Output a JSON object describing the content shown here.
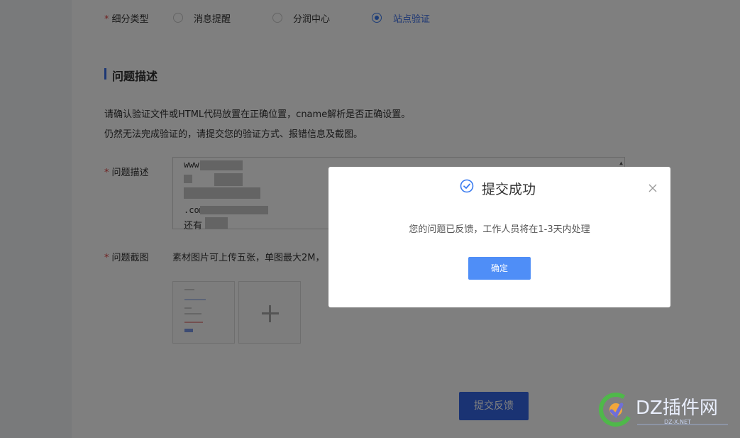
{
  "form": {
    "subtype": {
      "label": "细分类型",
      "options": [
        "消息提醒",
        "分润中心",
        "站点验证"
      ],
      "selected": "站点验证"
    },
    "section_title": "问题描述",
    "hint_line1": "请确认验证文件或HTML代码放置在正确位置，cname解析是否正确设置。",
    "hint_line2": "仍然无法完成验证的，请提交您的验证方式、报错信息及截图。",
    "desc_label": "问题描述",
    "desc_text": {
      "line1": "www.      .cn",
      "line2": "",
      "line3": "",
      "line4": "         .com",
      "line5": "还有"
    },
    "screenshot_label": "问题截图",
    "screenshot_hint": "素材图片可上传五张，单图最大2M，",
    "submit_label": "提交反馈"
  },
  "modal": {
    "title": "提交成功",
    "message": "您的问题已反馈，工作人员将在1-3天内处理",
    "ok_label": "确定"
  },
  "watermark": {
    "text": "DZ插件网",
    "subtext": "DZ-X.NET"
  },
  "colors": {
    "accent": "#3a6ee8",
    "required": "#e04444",
    "modal_button": "#4f8ef7"
  }
}
